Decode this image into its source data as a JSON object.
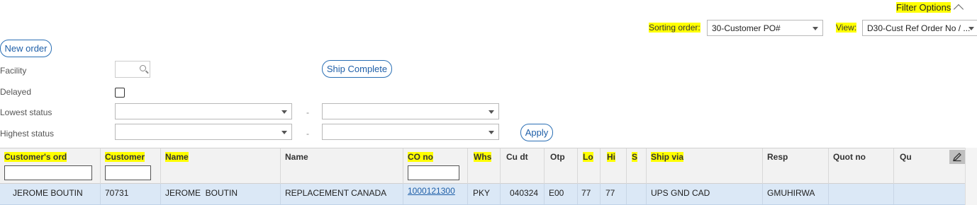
{
  "filter_options": {
    "label": "Filter Options",
    "icon": "chevron-up-icon"
  },
  "sorting": {
    "label": "Sorting order:",
    "value": "30-Customer PO#"
  },
  "view": {
    "label": "View:",
    "value": "D30-Cust Ref Order No / ..."
  },
  "buttons": {
    "new_order": "New order",
    "ship_complete": "Ship Complete",
    "apply": "Apply"
  },
  "filters": {
    "facility": "Facility",
    "delayed": "Delayed",
    "lowest_status": "Lowest status",
    "highest_status": "Highest status",
    "range_separator": "-"
  },
  "table": {
    "columns": [
      "Customer's ord",
      "Customer",
      "Name",
      "Name",
      "CO no",
      "Whs",
      "Cu dt",
      "Otp",
      "Lo",
      "Hi",
      "S",
      "Ship via",
      "Resp",
      "Quot no",
      "Qu"
    ],
    "rows": [
      [
        "JEROME BOUTIN",
        "70731",
        "JEROME  BOUTIN",
        "REPLACEMENT CANADA",
        "1000121300",
        "PKY",
        "040324",
        "E00",
        "77",
        "77",
        "",
        "UPS GND CAD",
        "GMUHIRWA",
        "",
        ""
      ]
    ]
  },
  "colors": {
    "highlight": "#ffff00",
    "accent": "#1f5fa8",
    "row_selected": "#dbe8f6",
    "header_bg": "#f2f2f2"
  }
}
